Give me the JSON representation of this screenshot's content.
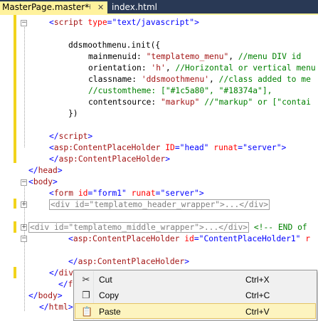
{
  "tabs": [
    {
      "label": "MasterPage.master*",
      "active": true
    },
    {
      "label": "index.html",
      "active": false
    }
  ],
  "icons": {
    "pin": "pin-icon",
    "close": "close-icon"
  },
  "code": {
    "l1": {
      "a": "<",
      "b": "script",
      "c": " type",
      "d": "=\"text/javascript\"",
      "e": ">"
    },
    "l3": "ddsmoothmenu.init({",
    "l4": {
      "a": "mainmenuid: ",
      "b": "\"templatemo_menu\"",
      "c": ", ",
      "d": "//menu DIV id"
    },
    "l5": {
      "a": "orientation: ",
      "b": "'h'",
      "c": ", ",
      "d": "//Horizontal or vertical menu"
    },
    "l6": {
      "a": "classname: ",
      "b": "'ddsmoothmenu'",
      "c": ", ",
      "d": "//class added to me"
    },
    "l7": "//customtheme: [\"#1c5a80\", \"#18374a\"],",
    "l8": {
      "a": "contentsource: ",
      "b": "\"markup\"",
      "c": " ",
      "d": "//\"markup\" or [\"contai"
    },
    "l9": "})",
    "l11": {
      "a": "</",
      "b": "script",
      "c": ">"
    },
    "l12": {
      "a": "<",
      "b": "asp:ContentPlaceHolder",
      "c": " ID",
      "d": "=\"head\"",
      "e": " runat",
      "f": "=\"server\"",
      "g": ">"
    },
    "l13": {
      "a": "</",
      "b": "asp:ContentPlaceHolder",
      "c": ">"
    },
    "l14": {
      "a": "</",
      "b": "head",
      "c": ">"
    },
    "l15": {
      "a": "<",
      "b": "body",
      "c": ">"
    },
    "l16": {
      "a": "<",
      "b": "form",
      "c": " id",
      "d": "=\"form1\"",
      "e": " runat",
      "f": "=\"server\"",
      "g": ">"
    },
    "l17": "<div id=\"templatemo_header_wrapper\">...</div>",
    "l19": {
      "box": "<div id=\"templatemo_middle_wrapper\">...</div>",
      "a": " <!-- END of"
    },
    "l20": {
      "a": "<",
      "b": "asp:ContentPlaceHolder",
      "c": " id",
      "d": "=\"ContentPlaceHolder1\"",
      "e": " r"
    },
    "l22": {
      "a": "</",
      "b": "asp:ContentPlaceHolder",
      "c": ">"
    },
    "l23": {
      "a": "</",
      "b": "div"
    },
    "l24": {
      "a": "</",
      "b": "for"
    },
    "l25": {
      "a": "</",
      "b": "body",
      "c": ">"
    },
    "l26": {
      "a": "</",
      "b": "html",
      "c": ">"
    }
  },
  "context_menu": {
    "items": [
      {
        "label": "Cut",
        "shortcut": "Ctrl+X",
        "icon": "scissors-icon"
      },
      {
        "label": "Copy",
        "shortcut": "Ctrl+C",
        "icon": "copy-icon"
      },
      {
        "label": "Paste",
        "shortcut": "Ctrl+V",
        "icon": "clipboard-icon"
      }
    ],
    "highlighted": "Paste"
  },
  "colors": {
    "tab_active": "#fff29d",
    "tab_strip": "#293955",
    "change_bar": "#f2d31b",
    "keyword": "#0000ff",
    "element": "#a31515",
    "attribute": "#ff0000",
    "comment": "#008000"
  }
}
